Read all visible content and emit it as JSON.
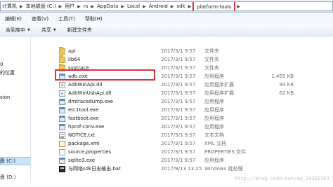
{
  "address_bar": {
    "crumbs": [
      "计算机",
      "本地磁盘 (C:)",
      "用户",
      "rs",
      "AppData",
      "Local",
      "Android",
      "sdk",
      "platform-tools"
    ]
  },
  "menu": [
    "编辑(E)",
    "查看(V)",
    "工具(T)",
    "帮助(H)"
  ],
  "commands": {
    "include_library": "含到库中",
    "share": "共享",
    "new_folder": "新建文件夹"
  },
  "nav": {
    "items": [
      "0",
      "的位置",
      "sion",
      "盘 (C:)",
      "盘 (D:)"
    ]
  },
  "files": [
    {
      "name": "api",
      "date": "2017/3/1 9:57",
      "type": "文件夹",
      "size": "",
      "icon": "folder-icon"
    },
    {
      "name": "lib64",
      "date": "2017/3/1 9:57",
      "type": "文件夹",
      "size": "",
      "icon": "folder-icon"
    },
    {
      "name": "systrace",
      "date": "2017/3/1 9:57",
      "type": "文件夹",
      "size": "",
      "icon": "folder-icon"
    },
    {
      "name": "adb.exe",
      "date": "2017/3/1 9:57",
      "type": "应用程序",
      "size": "1,455 KB",
      "icon": "exe-icon"
    },
    {
      "name": "AdbWinApi.dll",
      "date": "2017/3/1 9:57",
      "type": "应用程序扩展",
      "size": "94 KB",
      "icon": "dll-icon"
    },
    {
      "name": "AdbWinUsbApi.dll",
      "date": "2017/3/1 9:57",
      "type": "应用程序扩展",
      "size": "62 KB",
      "icon": "dll-icon"
    },
    {
      "name": "dmtracedump.exe",
      "date": "2017/3/1 9:57",
      "type": "应用程序",
      "size": "",
      "icon": "exe-icon"
    },
    {
      "name": "etc1tool.exe",
      "date": "2017/3/1 9:57",
      "type": "应用程序",
      "size": "",
      "icon": "exe-icon"
    },
    {
      "name": "fastboot.exe",
      "date": "2017/3/1 9:57",
      "type": "应用程序",
      "size": "",
      "icon": "exe-icon"
    },
    {
      "name": "hprof-conv.exe",
      "date": "2017/3/1 9:57",
      "type": "应用程序",
      "size": "",
      "icon": "exe-icon"
    },
    {
      "name": "NOTICE.txt",
      "date": "2017/3/1 9:57",
      "type": "文本文档",
      "size": "",
      "icon": "text-file-icon"
    },
    {
      "name": "package.xml",
      "date": "2017/3/1 9:57",
      "type": "XML 文档",
      "size": "",
      "icon": "xml-file-icon"
    },
    {
      "name": "source.properties",
      "date": "2017/3/1 9:57",
      "type": "PROPERTIES 文件",
      "size": "",
      "icon": "properties-file-icon"
    },
    {
      "name": "sqlite3.exe",
      "date": "2017/3/1 9:57",
      "type": "应用程序",
      "size": "",
      "icon": "exe-icon"
    },
    {
      "name": "与网络sdk日志输出.bat",
      "date": "2017/9/13 13:25",
      "type": "Windows 批处理",
      "size": "",
      "icon": "batch-file-icon"
    }
  ],
  "watermark": "http://blog.csdn.net/qq_24382363",
  "colors": {
    "highlight_red": "#d9343a",
    "folder": "#f0c85a",
    "toolbar_blue": "#dce6f4"
  }
}
